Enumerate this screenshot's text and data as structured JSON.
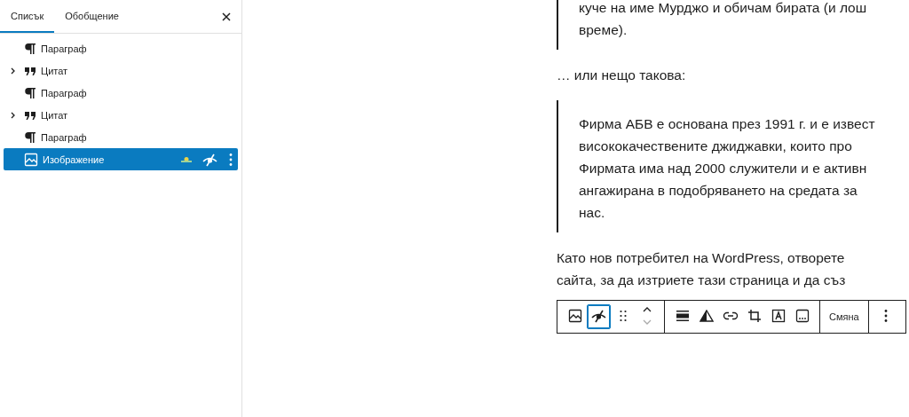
{
  "sidebar": {
    "tabs": [
      {
        "label": "Списък",
        "selected": true
      },
      {
        "label": "Обобщение",
        "selected": false
      }
    ],
    "items": [
      {
        "kind": "paragraph",
        "label": "Параграф",
        "has_children": false,
        "selected": false
      },
      {
        "kind": "quote",
        "label": "Цитат",
        "has_children": true,
        "expanded": false,
        "selected": false
      },
      {
        "kind": "paragraph",
        "label": "Параграф",
        "has_children": false,
        "selected": false
      },
      {
        "kind": "quote",
        "label": "Цитат",
        "has_children": true,
        "expanded": false,
        "selected": false
      },
      {
        "kind": "paragraph",
        "label": "Параграф",
        "has_children": false,
        "selected": false
      },
      {
        "kind": "image",
        "label": "Изображение",
        "has_children": false,
        "selected": true
      }
    ]
  },
  "content": {
    "blocks": [
      {
        "kind": "quote",
        "lines": [
          "куче на име Мурджо и обичам бирата (и лош",
          "време)."
        ]
      },
      {
        "kind": "paragraph",
        "lines": [
          "… или нещо такова:"
        ]
      },
      {
        "kind": "quote",
        "lines": [
          "Фирма АБВ е основана през 1991 г. и е извест",
          "висококачествените джиджавки, които про",
          "Фирмата има над 2000 служители и е активн",
          "ангажирана в подобряването на средата за",
          "нас."
        ]
      },
      {
        "kind": "paragraph",
        "lines": [
          "Като нов потребител на WordPress, отворете",
          "сайта, за да изтриете тази страница и да съз"
        ]
      }
    ]
  },
  "toolbar": {
    "groups": [
      {
        "buttons": [
          {
            "kind": "image",
            "selected": false
          },
          {
            "kind": "hide",
            "selected": true
          },
          {
            "kind": "drag",
            "selected": false
          },
          {
            "kind": "movers",
            "selected": false
          }
        ]
      },
      {
        "buttons": [
          {
            "kind": "align",
            "selected": false
          },
          {
            "kind": "duotone",
            "selected": false
          },
          {
            "kind": "link",
            "selected": false
          },
          {
            "kind": "crop",
            "selected": false
          },
          {
            "kind": "text-overlay",
            "selected": false
          },
          {
            "kind": "alt-text",
            "selected": false
          }
        ]
      },
      {
        "buttons": [
          {
            "kind": "text",
            "label": "Смяна",
            "selected": false
          }
        ]
      },
      {
        "buttons": [
          {
            "kind": "more",
            "selected": false
          }
        ]
      }
    ]
  }
}
